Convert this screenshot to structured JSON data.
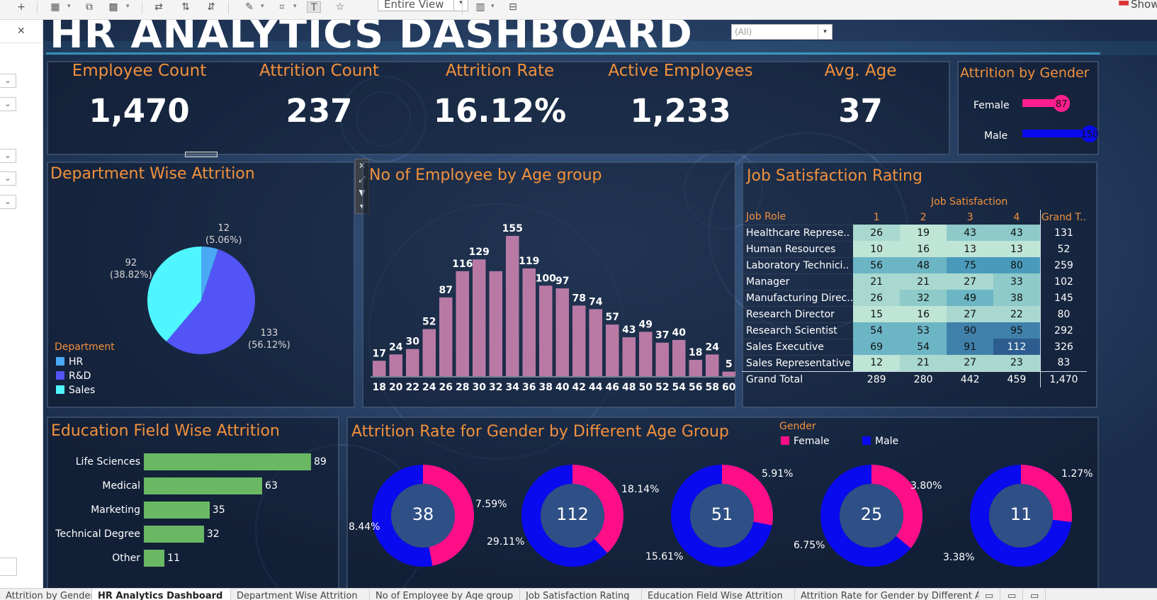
{
  "toolbar": {
    "view_value": "Entire View",
    "show_label": "Show"
  },
  "dashboard": {
    "title": "HR ANALYTICS DASHBOARD",
    "filter": {
      "value": "(All)"
    }
  },
  "kpis": [
    {
      "label": "Employee Count",
      "value": "1,470"
    },
    {
      "label": "Attrition Count",
      "value": "237"
    },
    {
      "label": "Attrition Rate",
      "value": "16.12%"
    },
    {
      "label": "Active Employees",
      "value": "1,233"
    },
    {
      "label": "Avg. Age",
      "value": "37"
    }
  ],
  "gender_attrition": {
    "title": "Attrition by Gender",
    "max": 150,
    "rows": [
      {
        "label": "Female",
        "value": 87,
        "color": "#ff1f8e"
      },
      {
        "label": "Male",
        "value": 150,
        "color": "#0a0aee"
      }
    ]
  },
  "department": {
    "title": "Department Wise Attrition",
    "legend_title": "Department",
    "slices": [
      {
        "name": "HR",
        "value": 12,
        "label": "12",
        "pct": "(5.06%)",
        "color": "#4aa9f5"
      },
      {
        "name": "R&D",
        "value": 133,
        "label": "133",
        "pct": "(56.12%)",
        "color": "#5254f6"
      },
      {
        "name": "Sales",
        "value": 92,
        "label": "92",
        "pct": "(38.82%)",
        "color": "#4ff6ff"
      }
    ]
  },
  "age_chart": {
    "title": "No of Employee by Age group",
    "bar_color": "#b87aa5",
    "categories": [
      "18",
      "20",
      "22",
      "24",
      "26",
      "28",
      "30",
      "32",
      "34",
      "36",
      "38",
      "40",
      "42",
      "44",
      "46",
      "48",
      "50",
      "52",
      "54",
      "56",
      "58",
      "60"
    ],
    "values": [
      17,
      24,
      30,
      52,
      87,
      116,
      129,
      116,
      155,
      119,
      100,
      97,
      78,
      74,
      57,
      43,
      49,
      37,
      40,
      18,
      24,
      5
    ],
    "labels": [
      "17",
      "24",
      "30",
      "52",
      "87",
      "116",
      "129",
      "",
      "155",
      "119",
      "100",
      "97",
      "78",
      "74",
      "57",
      "43",
      "49",
      "37",
      "40",
      "18",
      "24",
      "5"
    ]
  },
  "job_satisfaction": {
    "title": "Job Satisfaction Rating",
    "group_label": "Job Satisfaction",
    "role_header": "Job Role",
    "columns": [
      "1",
      "2",
      "3",
      "4"
    ],
    "gt_header": "Grand T..",
    "rows": [
      {
        "role": "Healthcare Represe..",
        "vals": [
          "26",
          "19",
          "43",
          "43"
        ],
        "total": "131"
      },
      {
        "role": "Human Resources",
        "vals": [
          "10",
          "16",
          "13",
          "13"
        ],
        "total": "52"
      },
      {
        "role": "Laboratory Technici..",
        "vals": [
          "56",
          "48",
          "75",
          "80"
        ],
        "total": "259"
      },
      {
        "role": "Manager",
        "vals": [
          "21",
          "21",
          "27",
          "33"
        ],
        "total": "102"
      },
      {
        "role": "Manufacturing Direc..",
        "vals": [
          "26",
          "32",
          "49",
          "38"
        ],
        "total": "145"
      },
      {
        "role": "Research Director",
        "vals": [
          "15",
          "16",
          "27",
          "22"
        ],
        "total": "80"
      },
      {
        "role": "Research Scientist",
        "vals": [
          "54",
          "53",
          "90",
          "95"
        ],
        "total": "292"
      },
      {
        "role": "Sales Executive",
        "vals": [
          "69",
          "54",
          "91",
          "112"
        ],
        "total": "326"
      },
      {
        "role": "Sales Representative",
        "vals": [
          "12",
          "21",
          "27",
          "23"
        ],
        "total": "83"
      }
    ],
    "total_row": {
      "role": "Grand Total",
      "vals": [
        "289",
        "280",
        "442",
        "459"
      ],
      "total": "1,470"
    }
  },
  "education": {
    "title": "Education Field Wise Attrition",
    "bar_color": "#6bb864",
    "max": 89,
    "rows": [
      {
        "label": "Life Sciences",
        "value": 89
      },
      {
        "label": "Medical",
        "value": 63
      },
      {
        "label": "Marketing",
        "value": 35
      },
      {
        "label": "Technical Degree",
        "value": 32
      },
      {
        "label": "Other",
        "value": 11
      }
    ]
  },
  "gender_age": {
    "title": "Attrition Rate for Gender by Different Age Group",
    "legend_title": "Gender",
    "legend": [
      {
        "name": "Female",
        "color": "#ff0f87"
      },
      {
        "name": "Male",
        "color": "#0a0aee"
      }
    ],
    "donuts": [
      {
        "center": "38",
        "female": "7.59%",
        "male": "8.44%",
        "female_share": 0.47
      },
      {
        "center": "112",
        "female": "18.14%",
        "male": "29.11%",
        "female_share": 0.38
      },
      {
        "center": "51",
        "female": "5.91%",
        "male": "15.61%",
        "female_share": 0.28
      },
      {
        "center": "25",
        "female": "3.80%",
        "male": "6.75%",
        "female_share": 0.36
      },
      {
        "center": "11",
        "female": "1.27%",
        "male": "3.38%",
        "female_share": 0.27
      }
    ]
  },
  "tabs": [
    "Attrition by Gender",
    "HR Analytics Dashboard",
    "Department Wise Attrition",
    "No of Employee by Age group",
    "Job Satisfaction Rating",
    "Education Field Wise Attrition",
    "Attrition Rate for Gender by Different Age Group"
  ]
}
